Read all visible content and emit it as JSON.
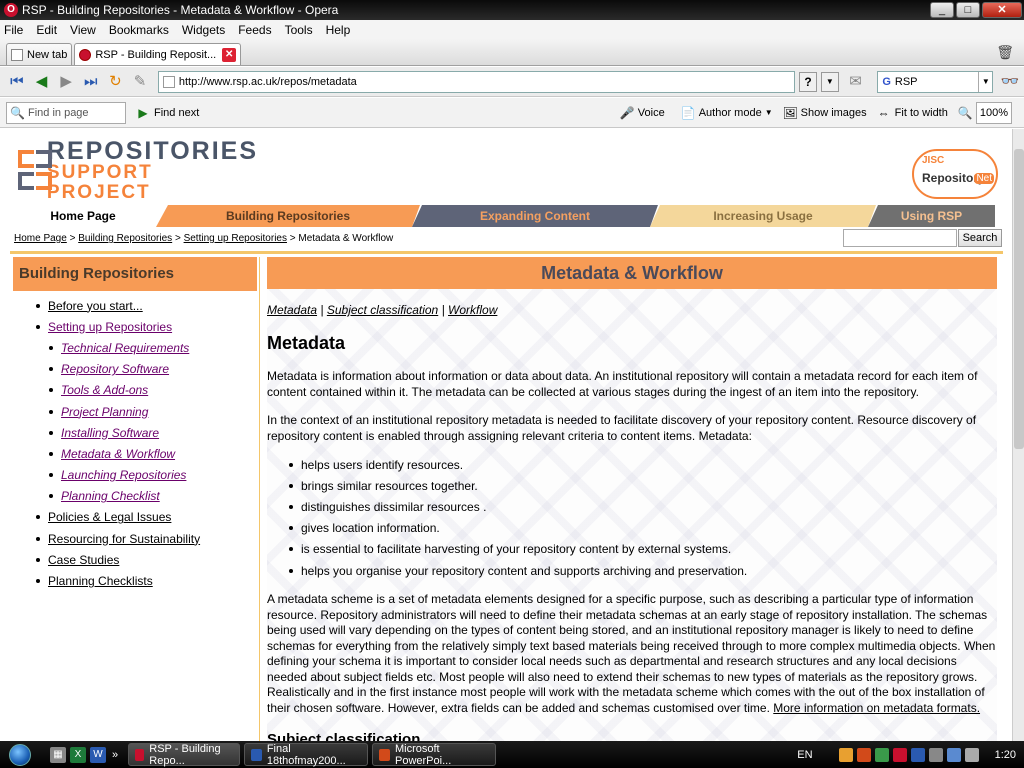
{
  "window": {
    "title": "RSP - Building Repositories - Metadata & Workflow - Opera",
    "minimize": "_",
    "maximize": "□",
    "close": "✕"
  },
  "menu": [
    "File",
    "Edit",
    "View",
    "Bookmarks",
    "Widgets",
    "Feeds",
    "Tools",
    "Help"
  ],
  "tabs": [
    {
      "label": "New tab",
      "active": false
    },
    {
      "label": "RSP - Building Reposit...",
      "active": true
    }
  ],
  "address": {
    "url": "http://www.rsp.ac.uk/repos/metadata",
    "search_engine_label": "RSP",
    "help": "?"
  },
  "toolbar": {
    "find_placeholder": "Find in page",
    "find_next": "Find next",
    "voice": "Voice",
    "author_mode": "Author mode",
    "show_images": "Show images",
    "fit_to_width": "Fit to width",
    "zoom": "100%"
  },
  "site": {
    "logo_line1": "REPOSITORIES",
    "logo_line2": "SUPPORT PROJECT",
    "jisc_line1": "JISC",
    "jisc_line2": "Repository",
    "jisc_line3": "Net",
    "nav": [
      "Home Page",
      "Building Repositories",
      "Expanding Content",
      "Increasing Usage",
      "Using RSP"
    ],
    "breadcrumb": {
      "home": "Home Page",
      "building": "Building Repositories",
      "setting_up": "Setting up Repositories",
      "current": "Metadata & Workflow",
      "sep": " > "
    },
    "search_button": "Search"
  },
  "sidebar": {
    "title": "Building Repositories",
    "items": [
      {
        "label": "Before you start...",
        "level": 1
      },
      {
        "label": "Setting up Repositories",
        "level": 1
      },
      {
        "label": "Technical Requirements",
        "level": 2
      },
      {
        "label": "Repository Software",
        "level": 2
      },
      {
        "label": "Tools & Add-ons",
        "level": 2
      },
      {
        "label": "Project Planning",
        "level": 2
      },
      {
        "label": "Installing Software",
        "level": 2
      },
      {
        "label": "Metadata & Workflow",
        "level": 2
      },
      {
        "label": "Launching Repositories",
        "level": 2
      },
      {
        "label": "Planning Checklist",
        "level": 2
      },
      {
        "label": "Policies & Legal Issues",
        "level": 1
      },
      {
        "label": "Resourcing for Sustainability",
        "level": 1
      },
      {
        "label": "Case Studies",
        "level": 1
      },
      {
        "label": "Planning Checklists",
        "level": 1
      }
    ]
  },
  "content": {
    "title": "Metadata & Workflow",
    "links": [
      "Metadata",
      "Subject classification",
      "Workflow"
    ],
    "link_sep": " | ",
    "heading": "Metadata",
    "para1": "Metadata is information about information or data about data. An institutional repository will contain a metadata record for each item of content contained within it. The metadata can be collected at various stages during the ingest of an item into the repository.",
    "para2": "In the context of an institutional repository metadata is needed to facilitate discovery of your repository content. Resource discovery of repository content is enabled through assigning relevant criteria to content items. Metadata:",
    "bullets": [
      "helps users identify resources.",
      "brings similar resources together.",
      "distinguishes dissimilar resources .",
      "gives location information.",
      "is essential to facilitate harvesting of your repository content by external systems.",
      "helps you organise your repository content and supports archiving and preservation."
    ],
    "para3": "A metadata scheme is a set of metadata elements designed for a specific purpose, such as describing a particular type of information resource. Repository administrators will need to define their metadata schemas at an early stage of repository installation. The schemas being used will vary depending on the types of content being stored, and an institutional repository manager is likely to need to define schemas for everything from the relatively simply text based materials being received through to more complex multimedia objects. When defining your schema it is important to consider local needs such as departmental and research structures and any local decisions needed about subject fields etc. Most people will also need to extend their schemas to new types of materials as the repository grows. Realistically and in the first instance most people will work with the metadata scheme which comes with the out of the box installation of their chosen software. However, extra fields can be added and schemas customised over time.",
    "para3_link": "More information on metadata formats.",
    "heading2": "Subject classification"
  },
  "taskbar": {
    "tasks": [
      {
        "label": "RSP - Building Repo...",
        "active": true
      },
      {
        "label": "Final 18thofmay200...",
        "active": false
      },
      {
        "label": "Microsoft PowerPoi...",
        "active": false
      }
    ],
    "more": "»",
    "lang": "EN",
    "clock": "1:20"
  },
  "colors": {
    "orange": "#f79b55",
    "slate": "#5e6478",
    "sand": "#f4d79b",
    "gray": "#707070",
    "gold_rule": "#f4c66a"
  }
}
